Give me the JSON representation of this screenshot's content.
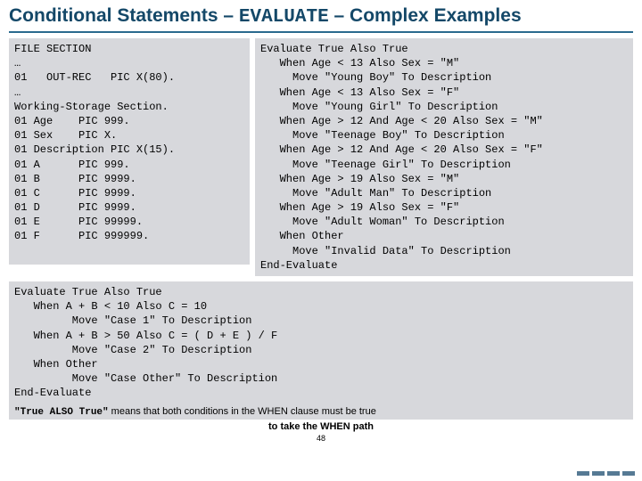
{
  "title": {
    "pre": "Conditional Statements – ",
    "mono": "EVALUATE",
    "post": " – Complex Examples"
  },
  "code": {
    "left": "FILE SECTION\n…\n01   OUT-REC   PIC X(80).\n…\nWorking-Storage Section.\n01 Age    PIC 999.\n01 Sex    PIC X.\n01 Description PIC X(15).\n01 A      PIC 999.\n01 B      PIC 9999.\n01 C      PIC 9999.\n01 D      PIC 9999.\n01 E      PIC 99999.\n01 F      PIC 999999.",
    "right": "Evaluate True Also True\n   When Age < 13 Also Sex = \"M\"\n     Move \"Young Boy\" To Description\n   When Age < 13 Also Sex = \"F\"\n     Move \"Young Girl\" To Description\n   When Age > 12 And Age < 20 Also Sex = \"M\"\n     Move \"Teenage Boy\" To Description\n   When Age > 12 And Age < 20 Also Sex = \"F\"\n     Move \"Teenage Girl\" To Description\n   When Age > 19 Also Sex = \"M\"\n     Move \"Adult Man\" To Description\n   When Age > 19 Also Sex = \"F\"\n     Move \"Adult Woman\" To Description\n   When Other\n     Move \"Invalid Data\" To Description\nEnd-Evaluate",
    "bottom": "Evaluate True Also True\n   When A + B < 10 Also C = 10\n         Move \"Case 1\" To Description\n   When A + B > 50 Also C = ( D + E ) / F\n         Move \"Case 2\" To Description\n   When Other\n         Move \"Case Other\" To Description\nEnd-Evaluate"
  },
  "footnote": {
    "quote": "\"True ALSO True\"",
    "line1_tail": " means that both conditions in the WHEN clause must be true",
    "line2": "to take the WHEN path"
  },
  "pagenum": "48"
}
